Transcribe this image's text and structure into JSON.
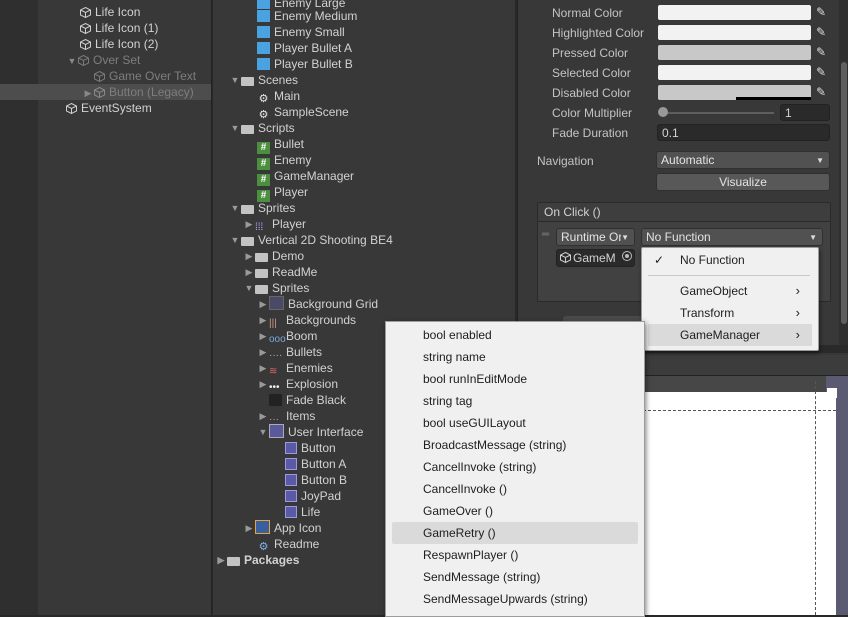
{
  "hierarchy": {
    "items": [
      {
        "label": "Life Icon"
      },
      {
        "label": "Life Icon (1)"
      },
      {
        "label": "Life Icon (2)"
      },
      {
        "label": "Over Set"
      },
      {
        "label": "Game Over Text"
      },
      {
        "label": "Button (Legacy)"
      },
      {
        "label": "EventSystem"
      }
    ]
  },
  "project": {
    "items": [
      {
        "label": "Enemy Large"
      },
      {
        "label": "Enemy Medium"
      },
      {
        "label": "Enemy Small"
      },
      {
        "label": "Player Bullet A"
      },
      {
        "label": "Player Bullet B"
      },
      {
        "label": "Scenes"
      },
      {
        "label": "Main"
      },
      {
        "label": "SampleScene"
      },
      {
        "label": "Scripts"
      },
      {
        "label": "Bullet"
      },
      {
        "label": "Enemy"
      },
      {
        "label": "GameManager"
      },
      {
        "label": "Player"
      },
      {
        "label": "Sprites"
      },
      {
        "label": "Player"
      },
      {
        "label": "Vertical 2D Shooting BE4"
      },
      {
        "label": "Demo"
      },
      {
        "label": "ReadMe"
      },
      {
        "label": "Sprites"
      },
      {
        "label": "Background Grid"
      },
      {
        "label": "Backgrounds"
      },
      {
        "label": "Boom"
      },
      {
        "label": "Bullets"
      },
      {
        "label": "Enemies"
      },
      {
        "label": "Explosion"
      },
      {
        "label": "Fade Black"
      },
      {
        "label": "Items"
      },
      {
        "label": "User Interface"
      },
      {
        "label": "Button"
      },
      {
        "label": "Button A"
      },
      {
        "label": "Button B"
      },
      {
        "label": "JoyPad"
      },
      {
        "label": "Life"
      },
      {
        "label": "App Icon"
      },
      {
        "label": "Readme"
      },
      {
        "label": "Packages"
      }
    ]
  },
  "inspector": {
    "normal_color": "Normal Color",
    "highlighted_color": "Highlighted Color",
    "pressed_color": "Pressed Color",
    "selected_color": "Selected Color",
    "disabled_color": "Disabled Color",
    "color_multiplier": "Color Multiplier",
    "color_multiplier_value": "1",
    "color_multiplier_fraction": 0.0,
    "fade_duration": "Fade Duration",
    "fade_duration_value": "0.1",
    "navigation": "Navigation",
    "navigation_value": "Automatic",
    "visualize": "Visualize",
    "on_click": "On Click ()",
    "runtime_mode": "Runtime Or",
    "function": "No Function",
    "target_object": "GameM",
    "colors": {
      "normal": "#f2f2f2",
      "highlighted": "#f2f2f2",
      "pressed": "#c8c8c8",
      "selected": "#f2f2f2",
      "disabled": "#c8c8c8"
    }
  },
  "function_menu": {
    "items": [
      {
        "label": "No Function",
        "checked": true
      },
      {
        "label": "GameObject"
      },
      {
        "label": "Transform"
      },
      {
        "label": "GameManager"
      }
    ]
  },
  "method_list": {
    "items": [
      {
        "label": "bool enabled"
      },
      {
        "label": "string name"
      },
      {
        "label": "bool runInEditMode"
      },
      {
        "label": "string tag"
      },
      {
        "label": "bool useGUILayout"
      },
      {
        "label": "BroadcastMessage (string)"
      },
      {
        "label": "CancelInvoke (string)"
      },
      {
        "label": "CancelInvoke ()"
      },
      {
        "label": "GameOver ()"
      },
      {
        "label": "GameRetry ()"
      },
      {
        "label": "RespawnPlayer ()"
      },
      {
        "label": "SendMessage (string)"
      },
      {
        "label": "SendMessageUpwards (string)"
      }
    ]
  }
}
